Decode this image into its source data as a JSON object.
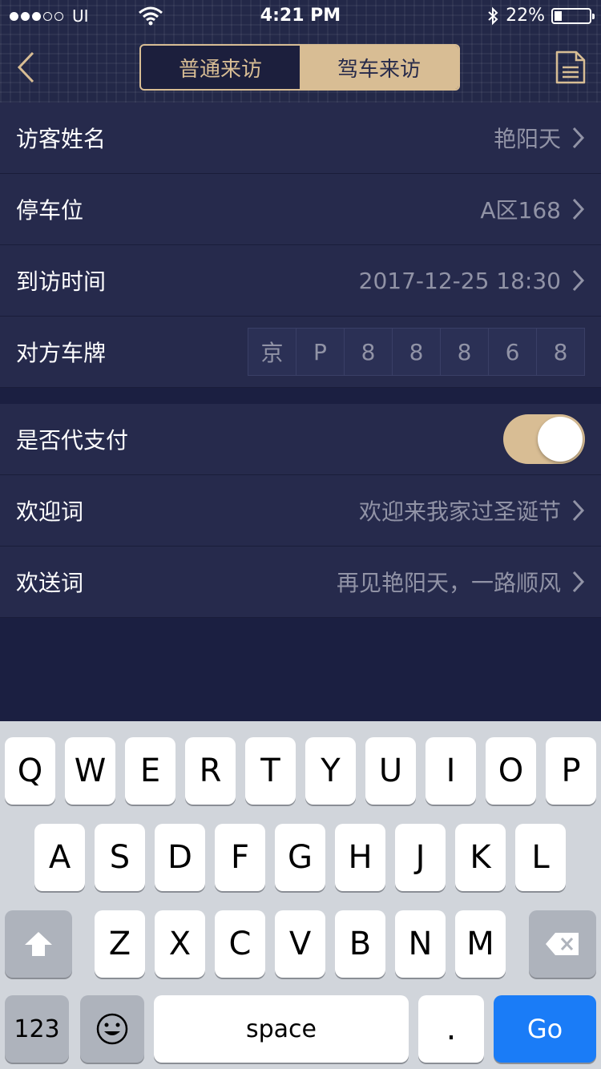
{
  "status": {
    "carrier": "UI",
    "time": "4:21 PM",
    "battery": "22%",
    "battery_level": 0.22
  },
  "header": {
    "tabs": [
      "普通来访",
      "驾车来访"
    ],
    "active_tab": 1
  },
  "form": {
    "visitor_label": "访客姓名",
    "visitor_value": "艳阳天",
    "parking_label": "停车位",
    "parking_value": "A区168",
    "time_label": "到访时间",
    "time_value": "2017-12-25 18:30",
    "plate_label": "对方车牌",
    "plate": [
      "京",
      "P",
      "8",
      "8",
      "8",
      "6",
      "8"
    ],
    "pay_label": "是否代支付",
    "pay_on": true,
    "welcome_label": "欢迎词",
    "welcome_value": "欢迎来我家过圣诞节",
    "farewell_label": "欢送词",
    "farewell_value": "再见艳阳天，一路顺风"
  },
  "keyboard": {
    "row1": [
      "Q",
      "W",
      "E",
      "R",
      "T",
      "Y",
      "U",
      "I",
      "O",
      "P"
    ],
    "row2": [
      "A",
      "S",
      "D",
      "F",
      "G",
      "H",
      "J",
      "K",
      "L"
    ],
    "row3": [
      "Z",
      "X",
      "C",
      "V",
      "B",
      "N",
      "M"
    ],
    "numbers": "123",
    "space": "space",
    "period": ".",
    "go": "Go"
  }
}
